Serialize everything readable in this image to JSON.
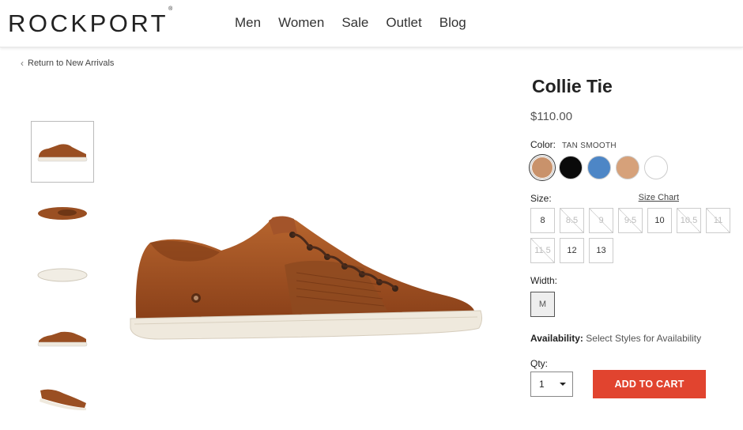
{
  "brand": {
    "logo_text": "ROCKPORT",
    "registered": "®"
  },
  "nav": {
    "items": [
      "Men",
      "Women",
      "Sale",
      "Outlet",
      "Blog"
    ]
  },
  "breadcrumb": {
    "back_label": "Return to New Arrivals"
  },
  "product": {
    "title": "Collie Tie",
    "price": "$110.00",
    "color_label": "Color:",
    "color_value": "TAN SMOOTH",
    "swatches": [
      {
        "name": "tan",
        "hex": "#c9926b",
        "selected": true
      },
      {
        "name": "black",
        "hex": "#0a0a0a",
        "selected": false
      },
      {
        "name": "blue",
        "hex": "#4d86c6",
        "selected": false
      },
      {
        "name": "tan-light",
        "hex": "#d6a17a",
        "selected": false
      },
      {
        "name": "white",
        "hex": "#ffffff",
        "selected": false
      }
    ],
    "size_label": "Size:",
    "size_chart_label": "Size Chart",
    "sizes": [
      {
        "label": "8",
        "available": true
      },
      {
        "label": "8.5",
        "available": false
      },
      {
        "label": "9",
        "available": false
      },
      {
        "label": "9.5",
        "available": false
      },
      {
        "label": "10",
        "available": true
      },
      {
        "label": "10.5",
        "available": false
      },
      {
        "label": "11",
        "available": false
      },
      {
        "label": "11.5",
        "available": false
      },
      {
        "label": "12",
        "available": true
      },
      {
        "label": "13",
        "available": true
      }
    ],
    "width_label": "Width:",
    "width_value": "M",
    "availability_label": "Availability:",
    "availability_text": "Select Styles for Availability",
    "qty_label": "Qty:",
    "qty_value": "1",
    "add_to_cart_label": "ADD TO CART"
  },
  "colors": {
    "accent": "#e1442f",
    "leather": "#9a4f22",
    "sole": "#efe9dd"
  }
}
